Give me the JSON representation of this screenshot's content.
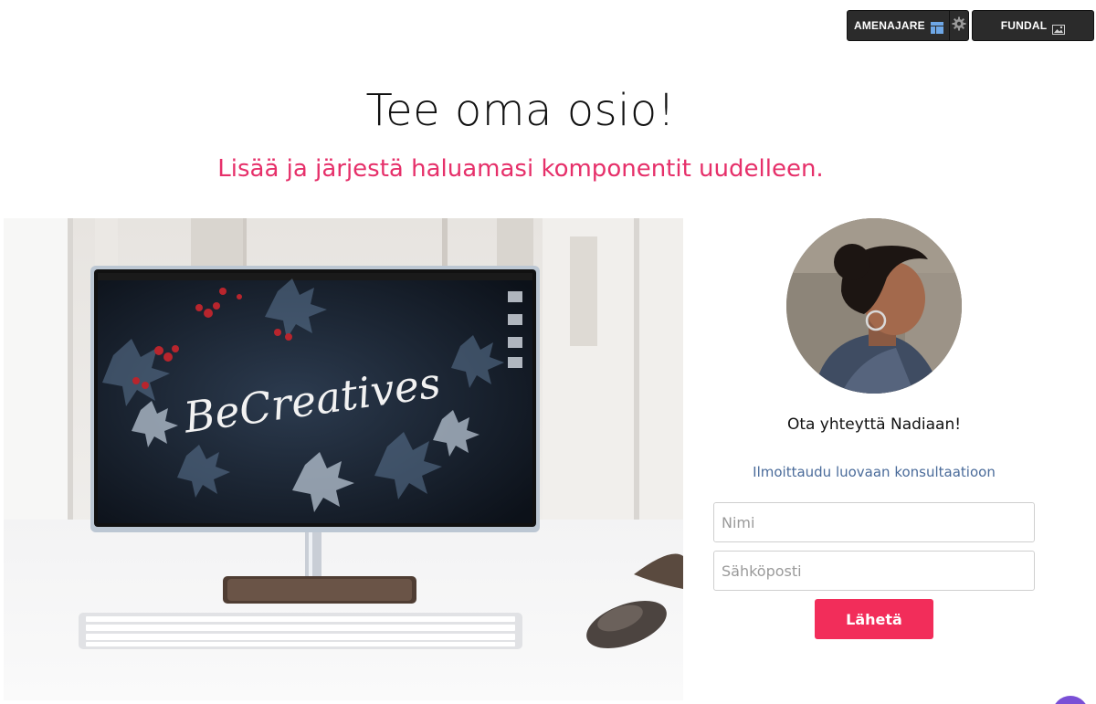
{
  "toolbar": {
    "layout_label": "AMENAJARE",
    "layout_icon": "layout-icon",
    "settings_icon": "gear-icon",
    "background_label": "FUNDAL",
    "background_icon": "image-icon"
  },
  "section": {
    "title": "Tee oma osio!",
    "subtitle": "Lisää ja järjestä haluamasi komponentit uudelleen."
  },
  "hero": {
    "screen_text": "BeCreatives"
  },
  "contact": {
    "heading": "Ota yhteyttä Nadiaan!",
    "subheading": "Ilmoittaudu luovaan konsultaatioon",
    "name_placeholder": "Nimi",
    "email_placeholder": "Sähköposti",
    "submit_label": "Lähetä"
  },
  "colors": {
    "accent": "#f22d5a",
    "subtitle": "#e6306a",
    "link": "#4a6b9a",
    "toolbar": "#2b2b2b",
    "chat": "#7a4fd6"
  }
}
